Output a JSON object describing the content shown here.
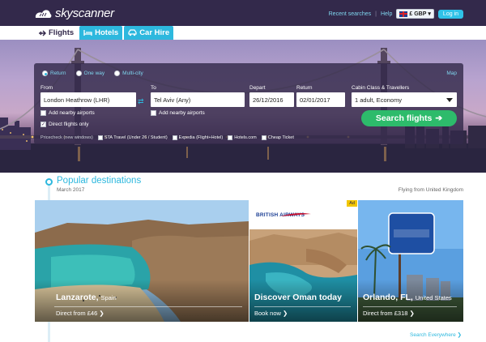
{
  "header": {
    "brand": "skyscanner",
    "recent_searches": "Recent searches",
    "separator": "|",
    "help": "Help",
    "currency": "£ GBP",
    "login": "Log in"
  },
  "tabs": [
    {
      "label": "Flights",
      "active": true
    },
    {
      "label": "Hotels",
      "active": false
    },
    {
      "label": "Car Hire",
      "active": false
    }
  ],
  "search": {
    "trip_types": [
      "Return",
      "One way",
      "Multi-city"
    ],
    "selected_trip_type": "Return",
    "map_link": "Map",
    "from_label": "From",
    "from_value": "London Heathrow (LHR)",
    "to_label": "To",
    "to_value": "Tel Aviv (Any)",
    "depart_label": "Depart",
    "depart_value": "26/12/2016",
    "return_label": "Return",
    "return_value": "02/01/2017",
    "cabin_label": "Cabin Class & Travellers",
    "cabin_value": "1 adult, Economy",
    "add_nearby_from": "Add nearby airports",
    "add_nearby_to": "Add nearby airports",
    "direct_only": "Direct flights only",
    "search_button": "Search flights",
    "pricecheck_title": "Pricecheck (new windows)",
    "pricecheck_options": [
      "STA Travel (Under 26 / Student)",
      "Expedia (Flight+Hotel)",
      "Hotels.com",
      "Cheap Ticket"
    ]
  },
  "popular": {
    "title": "Popular destinations",
    "date": "March 2017",
    "flying_from": "Flying from United Kingdom",
    "search_everywhere": "Search Everywhere",
    "cards": [
      {
        "city": "Lanzarote,",
        "country": "Spain",
        "link": "Direct from £46"
      },
      {
        "city": "Discover Oman today",
        "country": "",
        "link": "Book now",
        "ad": "Ad",
        "sponsor": "BRITISH AIRWAYS"
      },
      {
        "city": "Orlando, FL,",
        "country": "United States",
        "link": "Direct from £318"
      }
    ]
  },
  "colors": {
    "header_bg": "#33294b",
    "accent": "#2db8de",
    "cta": "#2dbb6b"
  }
}
